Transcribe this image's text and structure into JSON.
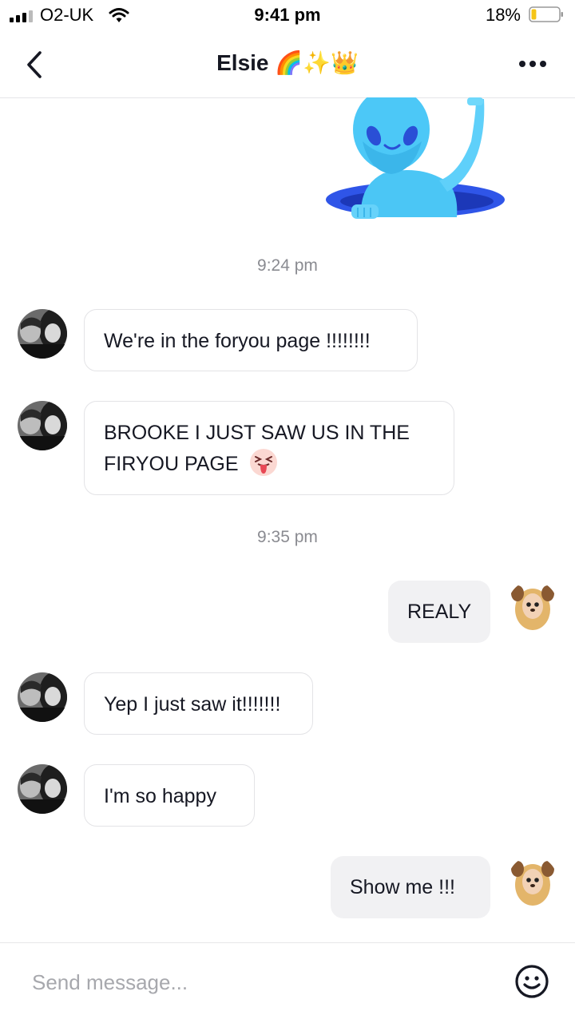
{
  "status_bar": {
    "carrier": "O2-UK",
    "time": "9:41 pm",
    "battery": "18%",
    "battery_level": 0.18
  },
  "header": {
    "title": "Elsie",
    "title_emoji": "🌈✨👑",
    "back_icon": "chevron-left-icon",
    "more_icon": "more-horizontal-icon"
  },
  "messages": [
    {
      "type": "sticker",
      "side": "out",
      "sticker": "waving-alien"
    },
    {
      "type": "timestamp",
      "text": "9:24 pm"
    },
    {
      "type": "text",
      "side": "in",
      "text": "We're in the foryou page !!!!!!!!"
    },
    {
      "type": "text",
      "side": "in",
      "text": "BROOKE I JUST SAW US IN THE FIRYOU PAGE",
      "emoji": "😝"
    },
    {
      "type": "timestamp",
      "text": "9:35 pm"
    },
    {
      "type": "text",
      "side": "out",
      "text": "REALY"
    },
    {
      "type": "text",
      "side": "in",
      "text": "Yep I just saw it!!!!!!!"
    },
    {
      "type": "text",
      "side": "in",
      "text": "I'm so happy"
    },
    {
      "type": "text",
      "side": "out",
      "text": "Show me !!!"
    }
  ],
  "composer": {
    "placeholder": "Send message...",
    "emoji_icon": "smiley-face-icon"
  },
  "colors": {
    "text": "#161823",
    "timestamp": "#8a8b91",
    "incoming_border": "#e3e3e6",
    "outgoing_bg": "#f1f1f3",
    "battery_fill": "#f5c518"
  }
}
